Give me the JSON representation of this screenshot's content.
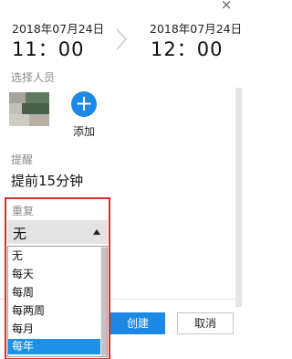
{
  "window": {
    "close_glyph": "×"
  },
  "schedule": {
    "start_date": "2018年07月24日",
    "start_time": "11：00",
    "end_date": "2018年07月24日",
    "end_time": "12：00"
  },
  "people": {
    "label": "选择人员",
    "add_label": "添加",
    "add_glyph": "+"
  },
  "reminder": {
    "label": "提醒",
    "value": "提前15分钟"
  },
  "repeat": {
    "label": "重复",
    "selected": "无",
    "options": [
      "无",
      "每天",
      "每周",
      "每两周",
      "每月",
      "每年"
    ],
    "highlighted_option": "每年"
  },
  "footer": {
    "create_label": "创建",
    "cancel_label": "取消"
  },
  "colors": {
    "accent": "#1e88e5",
    "highlight_box": "#d32f2f",
    "option_highlight": "#1e90e8"
  }
}
